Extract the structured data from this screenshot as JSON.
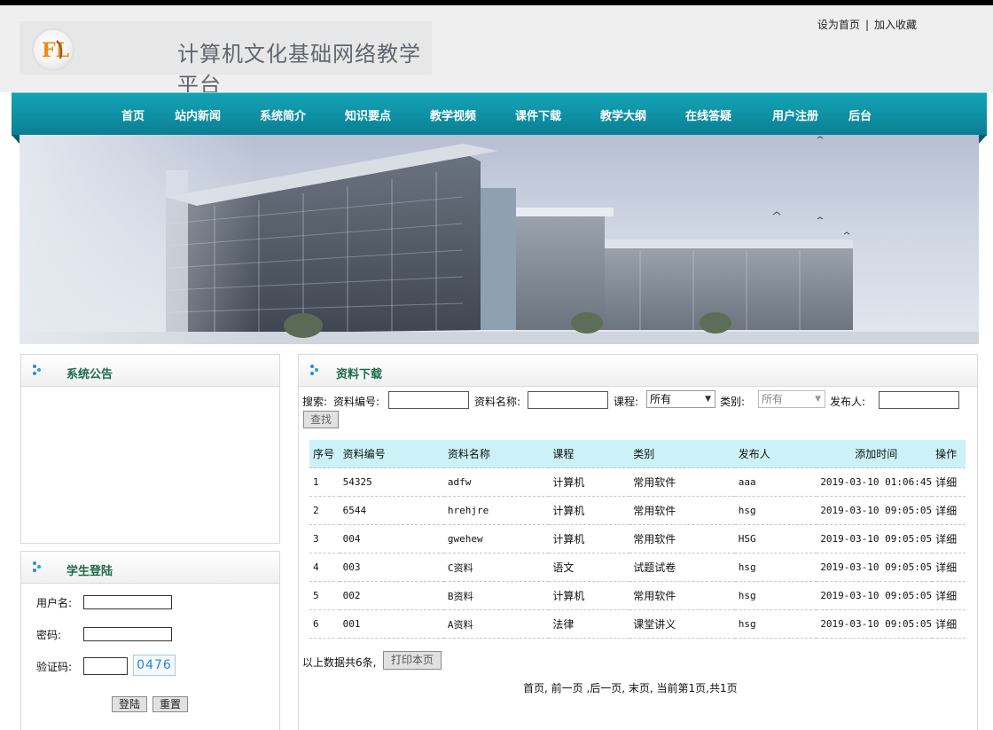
{
  "header": {
    "site_title": "计算机文化基础网络教学平台",
    "logo_text": "FL",
    "top_links": [
      "设为首页",
      "加入收藏"
    ],
    "top_link_separator": "|"
  },
  "nav": {
    "items": [
      "首页",
      "站内新闻",
      "系统简介",
      "知识要点",
      "教学视频",
      "课件下载",
      "教学大纲",
      "在线答疑",
      "用户注册",
      "后台"
    ],
    "color": "#13a3b6"
  },
  "notice_panel": {
    "title": "系统公告"
  },
  "login_panel": {
    "title": "学生登陆",
    "username_label": "用户名:",
    "password_label": "密码:",
    "captcha_label": "验证码:",
    "captcha_value": "0476",
    "login_button": "登陆",
    "reset_button": "重置"
  },
  "downloads_panel": {
    "title": "资料下载",
    "search": {
      "label_search": "搜索:",
      "label_code": "资料编号:",
      "label_name": "资料名称:",
      "label_course": "课程:",
      "course_value": "所有",
      "label_category": "类别:",
      "category_value": "所有",
      "label_publisher": "发布人:",
      "search_button": "查找"
    },
    "table": {
      "headers": [
        "序号",
        "资料编号",
        "资料名称",
        "课程",
        "类别",
        "发布人",
        "添加时间",
        "操作"
      ],
      "rows": [
        [
          "1",
          "54325",
          "adfw",
          "计算机",
          "常用软件",
          "aaa",
          "2019-03-10 01:06:45",
          "详细"
        ],
        [
          "2",
          "6544",
          "hrehjre",
          "计算机",
          "常用软件",
          "hsg",
          "2019-03-10 09:05:05",
          "详细"
        ],
        [
          "3",
          "004",
          "gwehew",
          "计算机",
          "常用软件",
          "HSG",
          "2019-03-10 09:05:05",
          "详细"
        ],
        [
          "4",
          "003",
          "C资料",
          "语文",
          "试题试卷",
          "hsg",
          "2019-03-10 09:05:05",
          "详细"
        ],
        [
          "5",
          "002",
          "B资料",
          "计算机",
          "常用软件",
          "hsg",
          "2019-03-10 09:05:05",
          "详细"
        ],
        [
          "6",
          "001",
          "A资料",
          "法律",
          "课堂讲义",
          "hsg",
          "2019-03-10 09:05:05",
          "详细"
        ]
      ]
    },
    "summary_text": "以上数据共6条,",
    "print_button": "打印本页",
    "pager_text": "首页, 前一页 ,后一页, 末页, 当前第1页,共1页"
  },
  "colors": {
    "accent": "#13a3b6",
    "panel_title": "#1c6b48",
    "table_header_bg": "#cbf3f7"
  }
}
